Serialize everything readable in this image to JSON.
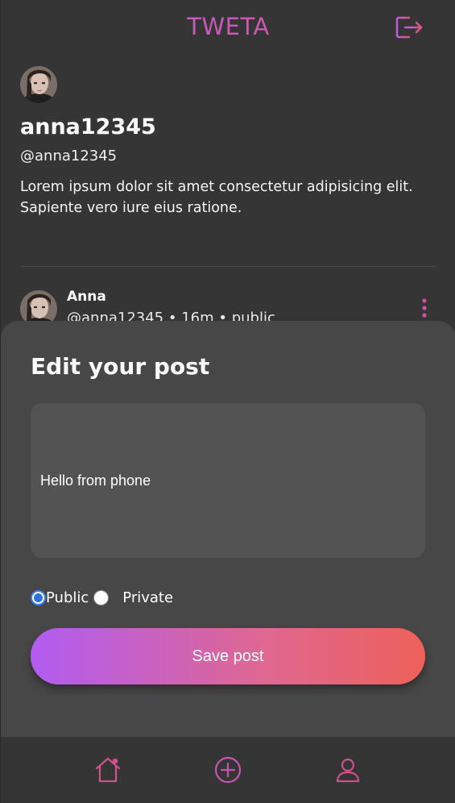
{
  "app": {
    "logo": "TWETA"
  },
  "header": {
    "logout_icon": "logout-icon"
  },
  "profile": {
    "username": "anna12345",
    "handle": "@anna12345",
    "bio": "Lorem ipsum dolor sit amet consectetur adipisicing elit. Sapiente vero iure eius ratione."
  },
  "post": {
    "author": "Anna",
    "meta": "@anna12345 • 16m • public",
    "menu_icon": "more-vertical-icon"
  },
  "edit_modal": {
    "title": "Edit your post",
    "text_value": "Hello from phone",
    "visibility_options": [
      {
        "label": "Public",
        "checked": true
      },
      {
        "label": "Private",
        "checked": false
      }
    ],
    "save_label": "Save post"
  },
  "bottom_nav": {
    "items": [
      {
        "name": "home",
        "icon": "home-icon"
      },
      {
        "name": "create",
        "icon": "plus-circle-icon"
      },
      {
        "name": "profile",
        "icon": "user-icon"
      }
    ]
  },
  "colors": {
    "background": "#353535",
    "sheet": "#474747",
    "gradient_start": "#b15cf2",
    "gradient_end": "#ee6159",
    "radio_accent": "#2f71e0"
  }
}
